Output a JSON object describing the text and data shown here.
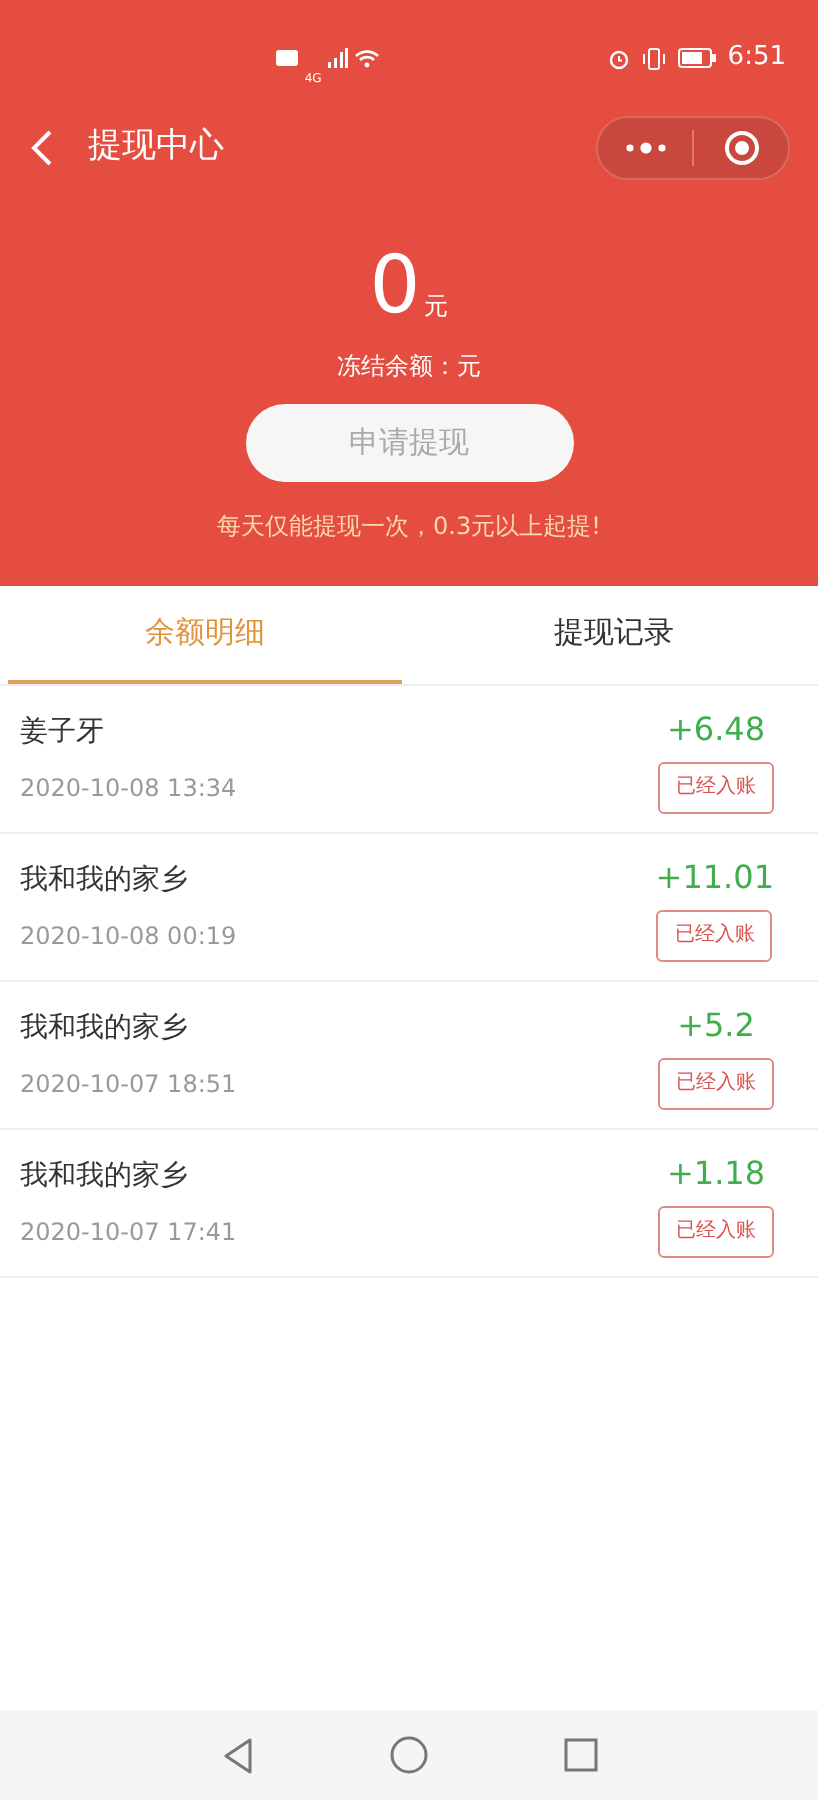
{
  "status_bar": {
    "time": "6:51",
    "network": "4G"
  },
  "header": {
    "title": "提现中心"
  },
  "balance": {
    "amount": "0",
    "unit": "元",
    "frozen": "冻结余额：元"
  },
  "withdraw_button": {
    "label": "申请提现",
    "disabled": true
  },
  "note": "每天仅能提现一次，0.3元以上起提!",
  "tabs": [
    {
      "label": "余额明细",
      "selected": true
    },
    {
      "label": "提现记录",
      "selected": false
    }
  ],
  "records": [
    {
      "title": "姜子牙",
      "time": "2020-10-08 13:34",
      "amount": "+6.48",
      "status": "已经入账"
    },
    {
      "title": "我和我的家乡",
      "time": "2020-10-08 00:19",
      "amount": "+11.01",
      "status": "已经入账"
    },
    {
      "title": "我和我的家乡",
      "time": "2020-10-07 18:51",
      "amount": "+5.2",
      "status": "已经入账"
    },
    {
      "title": "我和我的家乡",
      "time": "2020-10-07 17:41",
      "amount": "+1.18",
      "status": "已经入账"
    }
  ]
}
